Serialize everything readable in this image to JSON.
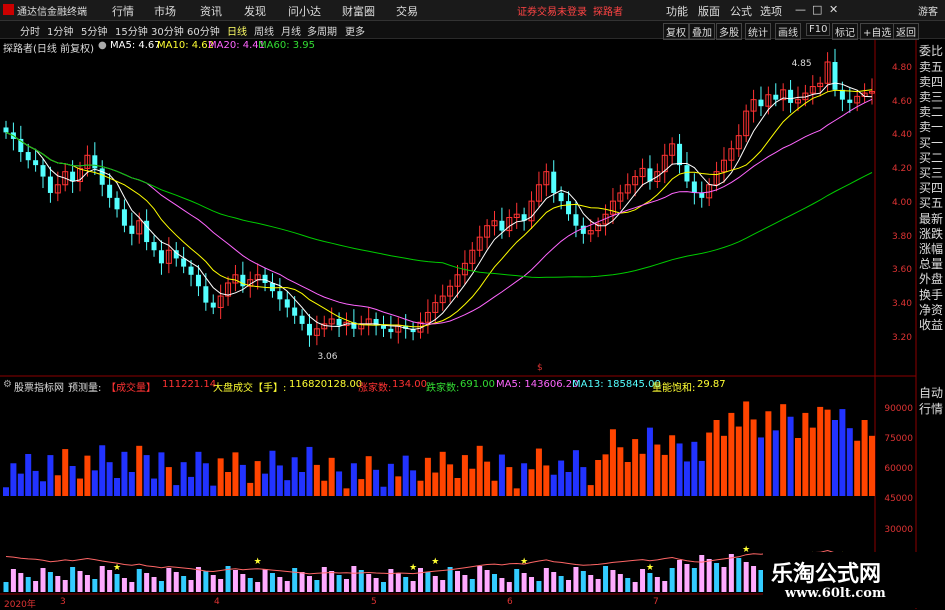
{
  "menubar": {
    "app_title": "通达信金融终端",
    "menus": [
      "行情",
      "市场",
      "资讯",
      "发现",
      "问小达",
      "财富圈",
      "交易"
    ],
    "login_notice": "证券交易未登录",
    "stock_name": "探路者",
    "right_items": [
      "功能",
      "版面",
      "公式",
      "选项"
    ],
    "guest": "游客",
    "window_buttons": [
      "—",
      "□",
      "✕"
    ]
  },
  "toolbar": {
    "periods": [
      "分时",
      "1分钟",
      "5分钟",
      "15分钟",
      "30分钟",
      "60分钟",
      "日线",
      "周线",
      "月线",
      "多周期",
      "更多"
    ],
    "active_period": "日线",
    "right_buttons": [
      "复权",
      "叠加",
      "多股",
      "统计",
      "画线",
      "F10",
      "标记",
      "+自选",
      "返回"
    ]
  },
  "price_panel": {
    "title": "探路者(日线 前复权)",
    "ma5": "MA5: 4.67",
    "ma10": "MA10: 4.62",
    "ma20": "MA20: 4.41",
    "ma60": "MA60: 3.95",
    "high_label": "4.85",
    "low_label": "3.06",
    "axis_ticks": [
      "4.80",
      "4.60",
      "4.40",
      "4.20",
      "4.00",
      "3.80",
      "3.60",
      "3.40",
      "3.20"
    ]
  },
  "volume_panel": {
    "indicator_name": "股票指标网",
    "forecast_label": "预测量:",
    "vol_label": "【成交量】",
    "vol_value": "111221.14",
    "market_label": "大盘成交【手】:",
    "market_value": "116820128.00",
    "up_label": "涨家数:",
    "up_value": "134.00",
    "down_label": "跌家数:",
    "down_value": "691.00",
    "ma5": "MA5: 143606.20",
    "ma13": "MA13: 185845.00",
    "saturation_label": "量能饱和:",
    "saturation_value": "29.87",
    "axis_ticks": [
      "90000",
      "75000",
      "60000",
      "45000",
      "30000"
    ]
  },
  "right_panel": {
    "items": [
      "委比",
      "卖五",
      "卖四",
      "卖三",
      "卖二",
      "卖一",
      "买一",
      "买二",
      "买三",
      "买四",
      "买五",
      "最新",
      "涨跌",
      "涨幅",
      "总量",
      "外盘",
      "换手",
      "净资",
      "收益"
    ],
    "bottom_items": [
      "自动",
      "行情"
    ]
  },
  "date_axis": {
    "labels": [
      "2020年",
      "3",
      "4",
      "5",
      "6",
      "7"
    ],
    "marker": "$"
  },
  "watermark": {
    "site_name": "乐淘公式网",
    "url": "www.60lt.com"
  },
  "colors": {
    "up": "#ff3333",
    "down": "#54ffff",
    "ma5": "#ffffff",
    "ma10": "#ffff00",
    "ma20": "#ff66ff",
    "ma60": "#00cc00",
    "vol_up": "#ff4400",
    "vol_down": "#2233ff",
    "vol_pink": "#ffaaff",
    "vol_cyan": "#33ccff"
  },
  "chart_data": {
    "type": "candlestick",
    "x": [
      1,
      2,
      3,
      4,
      5,
      6,
      7,
      8,
      9,
      10,
      11,
      12,
      13,
      14,
      15,
      16,
      17,
      18,
      19,
      20,
      21,
      22,
      23,
      24,
      25,
      26,
      27,
      28,
      29,
      30,
      31,
      32,
      33,
      34,
      35,
      36,
      37,
      38,
      39,
      40,
      41,
      42,
      43,
      44,
      45,
      46,
      47,
      48,
      49,
      50,
      51,
      52,
      53,
      54,
      55,
      56,
      57,
      58,
      59,
      60,
      61,
      62,
      63,
      64,
      65,
      66,
      67,
      68,
      69,
      70,
      71,
      72,
      73,
      74,
      75,
      76,
      77,
      78,
      79,
      80,
      81,
      82,
      83,
      84,
      85,
      86,
      87,
      88,
      89,
      90,
      91,
      92,
      93,
      94,
      95,
      96,
      97,
      98,
      99,
      100,
      101,
      102,
      103,
      104,
      105,
      106,
      107,
      108,
      109,
      110,
      111,
      112,
      113,
      114,
      115,
      116,
      117,
      118
    ],
    "close": [
      4.42,
      4.38,
      4.3,
      4.25,
      4.22,
      4.15,
      4.05,
      4.1,
      4.18,
      4.12,
      4.2,
      4.28,
      4.2,
      4.1,
      4.02,
      3.95,
      3.85,
      3.8,
      3.88,
      3.75,
      3.7,
      3.62,
      3.7,
      3.65,
      3.6,
      3.55,
      3.48,
      3.38,
      3.35,
      3.42,
      3.5,
      3.55,
      3.48,
      3.52,
      3.55,
      3.5,
      3.45,
      3.4,
      3.35,
      3.3,
      3.25,
      3.18,
      3.22,
      3.25,
      3.28,
      3.24,
      3.26,
      3.22,
      3.25,
      3.28,
      3.24,
      3.22,
      3.2,
      3.24,
      3.22,
      3.2,
      3.26,
      3.32,
      3.38,
      3.42,
      3.48,
      3.55,
      3.62,
      3.7,
      3.78,
      3.85,
      3.88,
      3.82,
      3.9,
      3.92,
      3.88,
      4.0,
      4.1,
      4.18,
      4.05,
      4.0,
      3.92,
      3.85,
      3.8,
      3.82,
      3.86,
      3.92,
      4.0,
      4.05,
      4.1,
      4.15,
      4.2,
      4.12,
      4.18,
      4.28,
      4.35,
      4.22,
      4.12,
      4.05,
      4.02,
      4.1,
      4.18,
      4.25,
      4.32,
      4.4,
      4.55,
      4.62,
      4.58,
      4.65,
      4.62,
      4.68,
      4.6,
      4.62,
      4.66,
      4.7,
      4.72,
      4.85,
      4.68,
      4.62,
      4.6,
      4.64,
      4.66,
      4.67
    ],
    "volume_axis": [
      90000,
      75000,
      60000,
      45000,
      30000
    ],
    "ylim": [
      3.06,
      4.85
    ],
    "ma_values": {
      "MA5": 4.67,
      "MA10": 4.62,
      "MA20": 4.41,
      "MA60": 3.95
    }
  }
}
